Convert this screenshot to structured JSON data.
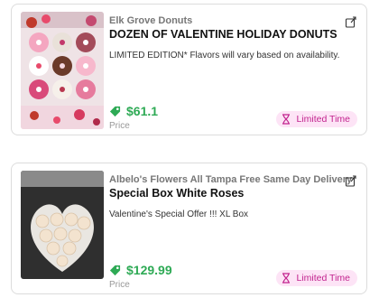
{
  "products": [
    {
      "vendor": "Elk Grove Donuts",
      "title": "DOZEN OF VALENTINE HOLIDAY DONUTS",
      "description": "LIMITED EDITION* Flavors will vary based on availability.",
      "price": "$61.1",
      "price_label": "Price",
      "badge": "Limited Time"
    },
    {
      "vendor": "Albelo's Flowers All Tampa Free Same Day Delivery",
      "title": "Special Box White Roses",
      "description": "Valentine's Special Offer !!! XL Box",
      "price": "$129.99",
      "price_label": "Price",
      "badge": "Limited Time"
    }
  ],
  "colors": {
    "price": "#2eaa55",
    "badge_bg": "#fde4f6",
    "badge_text": "#c2238e"
  },
  "icons": {
    "share": "share-box-icon",
    "price_tag": "tag-icon",
    "badge": "hourglass-icon"
  }
}
